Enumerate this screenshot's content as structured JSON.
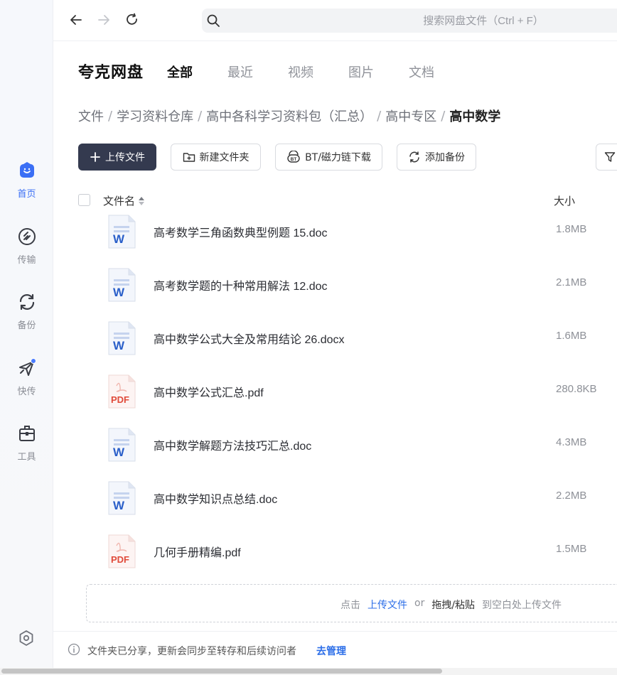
{
  "sidebar": {
    "items": [
      {
        "label": "首页",
        "icon": "home-icon",
        "active": true
      },
      {
        "label": "传输",
        "icon": "transfer-icon"
      },
      {
        "label": "备份",
        "icon": "backup-icon"
      },
      {
        "label": "快传",
        "icon": "quick-send-icon",
        "badge": true
      },
      {
        "label": "工具",
        "icon": "toolbox-icon"
      }
    ],
    "settings_icon": "settings-icon"
  },
  "topbar": {
    "search_placeholder": "搜索网盘文件（Ctrl + F）"
  },
  "brand": "夸克网盘",
  "tabs": [
    {
      "label": "全部",
      "active": true
    },
    {
      "label": "最近"
    },
    {
      "label": "视频"
    },
    {
      "label": "图片"
    },
    {
      "label": "文档"
    }
  ],
  "breadcrumb": [
    "文件",
    "学习资料仓库",
    "高中各科学习资料包（汇总）",
    "高中专区",
    "高中数学"
  ],
  "toolbar": {
    "upload": "上传文件",
    "new_folder": "新建文件夹",
    "bt_download": "BT/磁力链下载",
    "add_backup": "添加备份"
  },
  "list_header": {
    "name": "文件名",
    "size": "大小"
  },
  "files": [
    {
      "name": "高考数学三角函数典型例题  15.doc",
      "size": "1.8MB",
      "type": "word"
    },
    {
      "name": "高考数学题的十种常用解法 12.doc",
      "size": "2.1MB",
      "type": "word"
    },
    {
      "name": "高中数学公式大全及常用结论 26.docx",
      "size": "1.6MB",
      "type": "word"
    },
    {
      "name": "高中数学公式汇总.pdf",
      "size": "280.8KB",
      "type": "pdf"
    },
    {
      "name": "高中数学解题方法技巧汇总.doc",
      "size": "4.3MB",
      "type": "word"
    },
    {
      "name": "高中数学知识点总结.doc",
      "size": "2.2MB",
      "type": "word"
    },
    {
      "name": "几何手册精编.pdf",
      "size": "1.5MB",
      "type": "pdf"
    }
  ],
  "dropzone": {
    "click": "点击",
    "upload_link": "上传文件",
    "or": "or",
    "drag": "拖拽/粘贴",
    "to_blank": "到空白处上传文件"
  },
  "bottombar": {
    "text": "文件夹已分享，更新会同步至转存和后续访问者",
    "link": "去管理"
  },
  "colors": {
    "accent": "#3b6ff5",
    "primary_button": "#343a4f",
    "link": "#2c6ee8",
    "word_icon": "#2a5fc9",
    "pdf_icon": "#e04a3a"
  }
}
